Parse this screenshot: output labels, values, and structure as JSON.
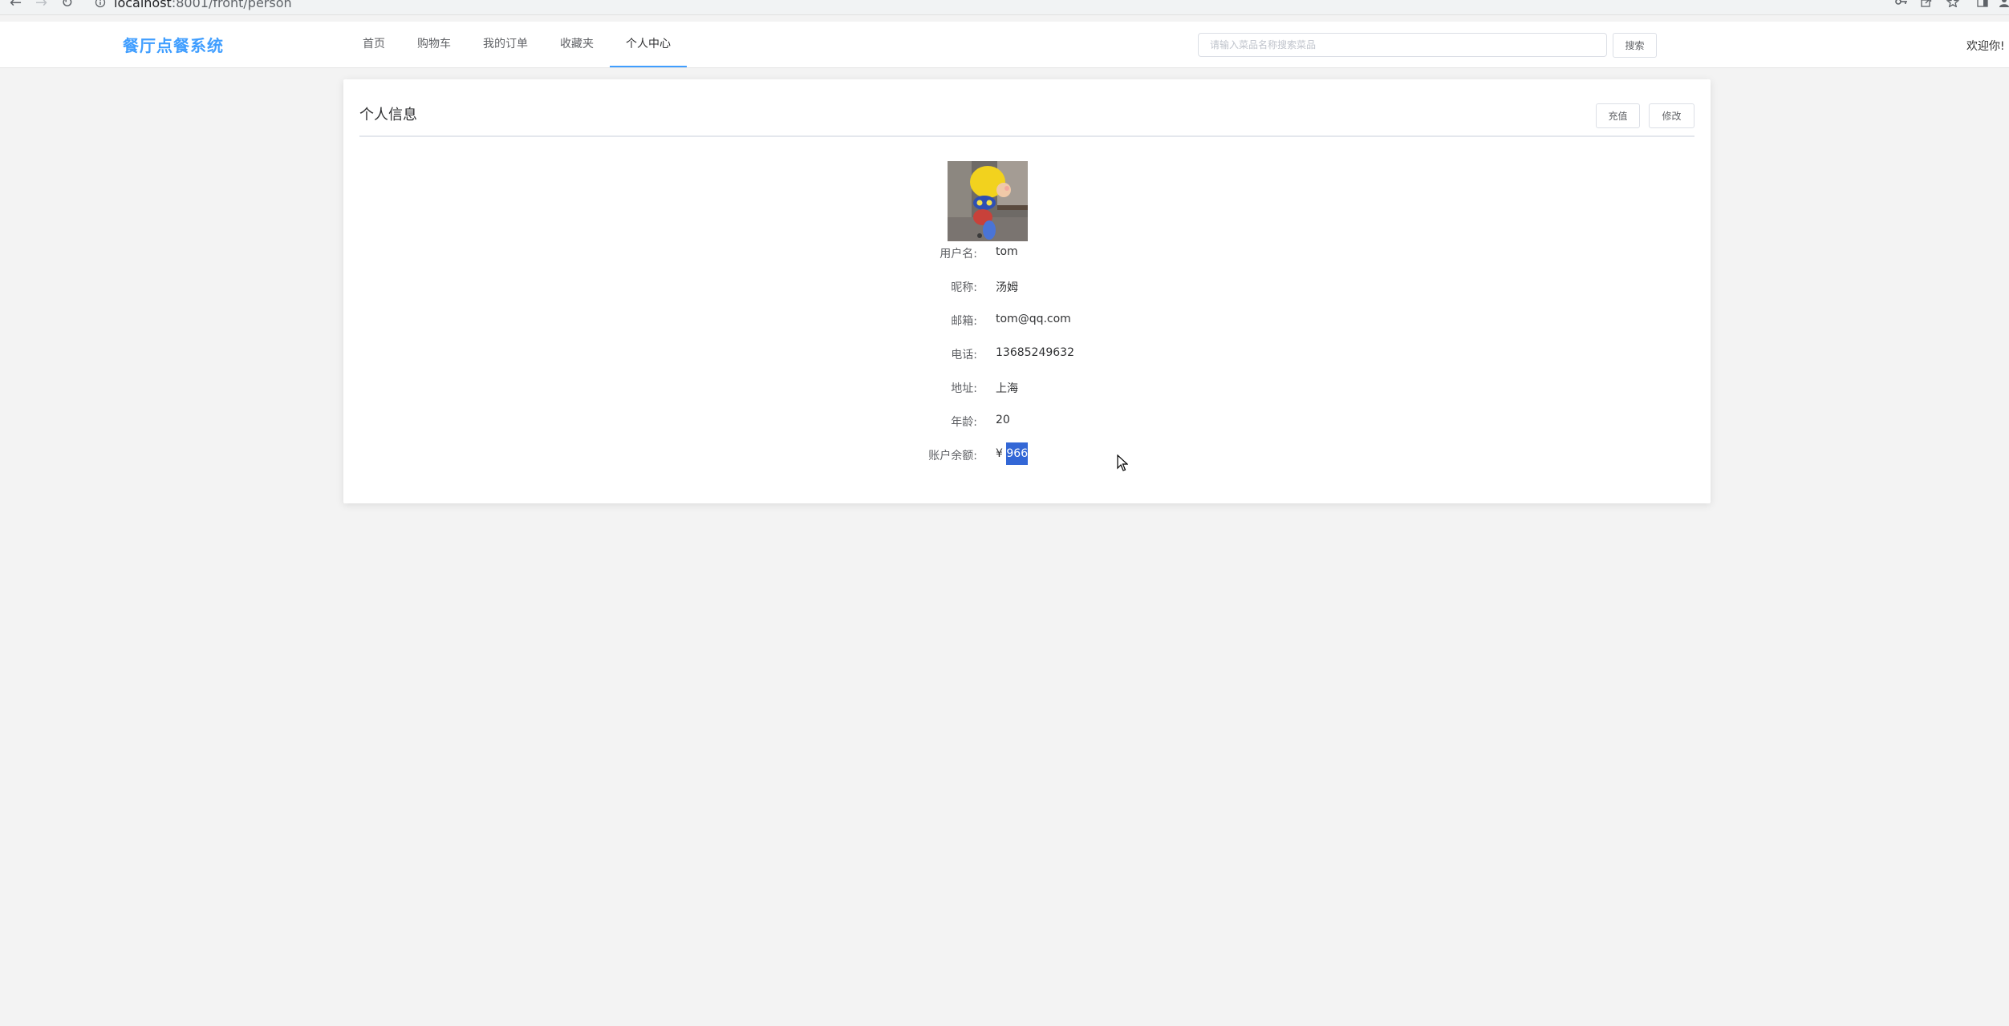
{
  "browser": {
    "back_icon": "←",
    "forward_icon": "→",
    "reload_icon": "↻",
    "url_host": "localhost",
    "url_path": ":8001/front/person"
  },
  "header": {
    "logo": "餐厅点餐系统",
    "nav": [
      {
        "label": "首页",
        "active": false
      },
      {
        "label": "购物车",
        "active": false
      },
      {
        "label": "我的订单",
        "active": false
      },
      {
        "label": "收藏夹",
        "active": false
      },
      {
        "label": "个人中心",
        "active": true
      }
    ],
    "search_placeholder": "请输入菜品名称搜索菜品",
    "search_button": "搜索",
    "welcome": "欢迎你!"
  },
  "card": {
    "title": "个人信息",
    "recharge_button": "充值",
    "edit_button": "修改",
    "fields": {
      "username_label": "用户名:",
      "username": "tom",
      "nickname_label": "昵称:",
      "nickname": "汤姆",
      "email_label": "邮箱:",
      "email": "tom@qq.com",
      "phone_label": "电话:",
      "phone": "13685249632",
      "address_label": "地址:",
      "address": "上海",
      "age_label": "年龄:",
      "age": "20",
      "balance_label": "账户余额:",
      "currency": "¥",
      "balance": "966"
    }
  },
  "colors": {
    "accent": "#409eff",
    "page_bg": "#f3f3f3",
    "selection": "#3367d6"
  }
}
